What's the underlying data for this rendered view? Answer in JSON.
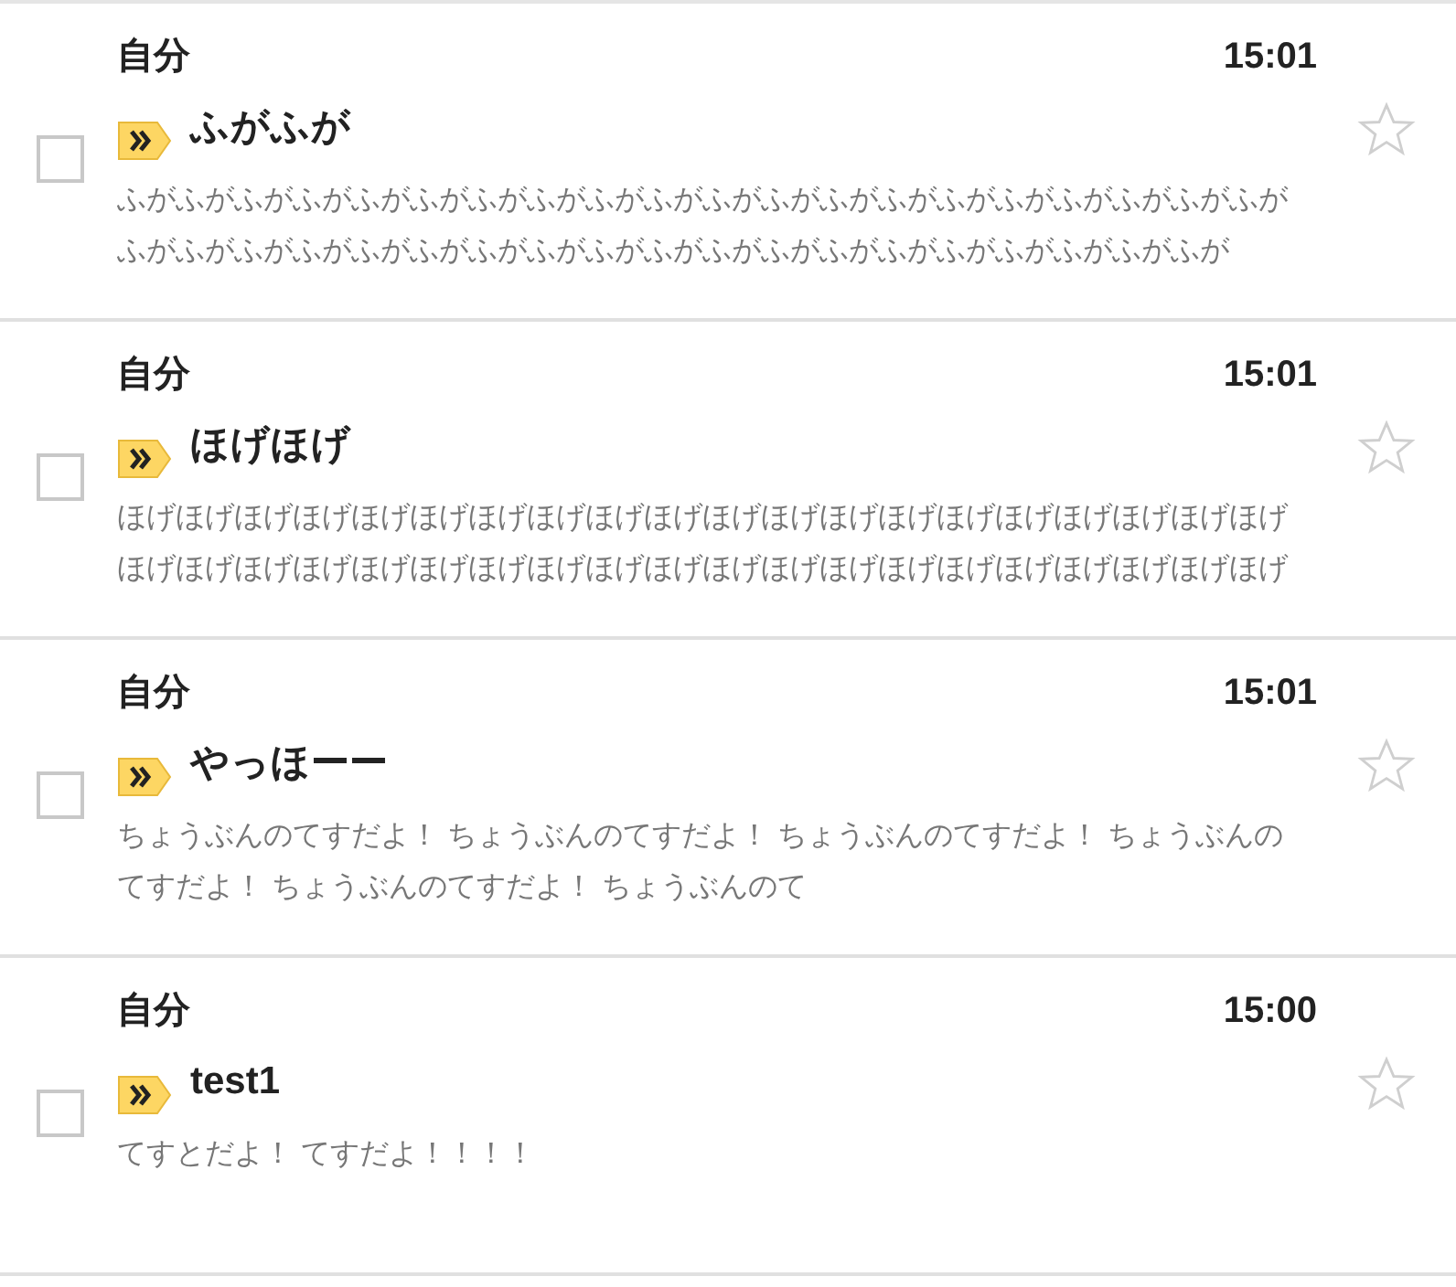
{
  "messages": [
    {
      "sender": "自分",
      "time": "15:01",
      "subject": "ふがふが",
      "snippet": "ふがふがふがふがふがふがふがふがふがふがふがふがふがふがふがふがふがふがふがふがふがふがふがふがふがふがふがふがふがふがふがふがふがふがふがふがふがふがふが",
      "checked": false,
      "starred": false,
      "important": true
    },
    {
      "sender": "自分",
      "time": "15:01",
      "subject": "ほげほげ",
      "snippet": "ほげほげほげほげほげほげほげほげほげほげほげほげほげほげほげほげほげほげほげほげほげほげほげほげほげほげほげほげほげほげほげほげほげほげほげほげほげほげほげほげ",
      "checked": false,
      "starred": false,
      "important": true
    },
    {
      "sender": "自分",
      "time": "15:01",
      "subject": "やっほーー",
      "snippet": "ちょうぶんのてすだよ！ ちょうぶんのてすだよ！ ちょうぶんのてすだよ！ ちょうぶんのてすだよ！ ちょうぶんのてすだよ！ ちょうぶんのて",
      "checked": false,
      "starred": false,
      "important": true
    },
    {
      "sender": "自分",
      "time": "15:00",
      "subject": "test1",
      "snippet": "てすとだよ！ てすだよ！！！！",
      "checked": false,
      "starred": false,
      "important": true
    }
  ]
}
